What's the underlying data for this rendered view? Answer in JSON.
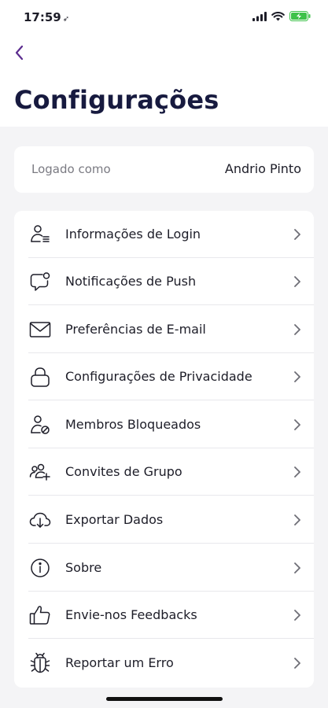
{
  "status_bar": {
    "time": "17:59",
    "location_glyph": "➶",
    "battery_color": "#3ec24a"
  },
  "header": {
    "title": "Configurações",
    "back_icon": "chevron-left-icon",
    "accent": "#5b2c8f"
  },
  "account": {
    "label": "Logado como",
    "value": "Andrio Pinto"
  },
  "menu": {
    "items": [
      {
        "label": "Informações de Login",
        "icon": "user-list-icon"
      },
      {
        "label": "Notificações de Push",
        "icon": "chat-bell-icon"
      },
      {
        "label": "Preferências de E-mail",
        "icon": "mail-icon"
      },
      {
        "label": "Configurações de Privacidade",
        "icon": "lock-icon"
      },
      {
        "label": "Membros Bloqueados",
        "icon": "user-blocked-icon"
      },
      {
        "label": "Convites de Grupo",
        "icon": "group-add-icon"
      },
      {
        "label": "Exportar Dados",
        "icon": "cloud-download-icon"
      },
      {
        "label": "Sobre",
        "icon": "info-icon"
      },
      {
        "label": "Envie-nos Feedbacks",
        "icon": "thumbs-up-icon"
      },
      {
        "label": "Reportar um Erro",
        "icon": "bug-icon"
      }
    ]
  }
}
